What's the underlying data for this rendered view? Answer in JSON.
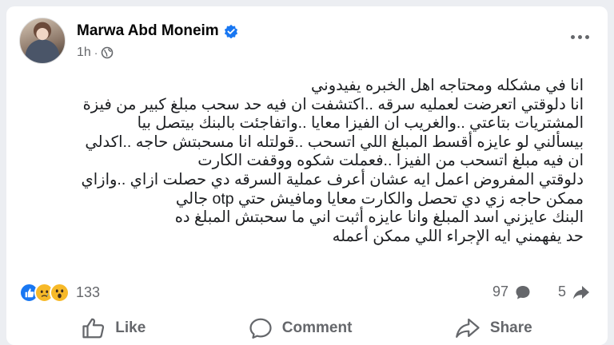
{
  "post": {
    "author": "Marwa Abd Moneim",
    "time": "1h",
    "lines": [
      "انا في مشكله ومحتاجه اهل الخبره يفيدوني",
      "انا دلوقتي اتعرضت لعمليه سرقه ..اكتشفت ان فيه حد سحب مبلغ كبير من فيزة",
      "المشتريات بتاعتي ..والغريب ان الفيزا معايا ..واتفاجئت بالبنك بيتصل بيا",
      "بيسألني لو عايزه أقسط المبلغ اللي اتسحب ..قولتله انا مسحبتش حاجه ..اكدلي",
      "ان فيه مبلغ اتسحب من الفيزا ..فعملت شكوه ووقفت الكارت",
      "دلوقتي المفروض اعمل ايه عشان أعرف عملية السرقه دي حصلت ازاي ..وازاي",
      "ممكن حاجه زي دي تحصل والكارت معايا ومافيش حتي otp جالي",
      "البنك عايزني اسد المبلغ وانا عايزه أثبت اني ما سحبتش المبلغ ده",
      "حد يفهمني ايه الإجراء اللي ممكن أعمله"
    ]
  },
  "stats": {
    "reactions_count": "133",
    "comments_count": "97",
    "shares_count": "5"
  },
  "actions": {
    "like": "Like",
    "comment": "Comment",
    "share": "Share"
  },
  "icons": {
    "verified": "verified-badge-icon",
    "audience": "public-globe-icon",
    "more": "more-options-icon",
    "reactions": [
      "like-reaction-icon",
      "sad-reaction-icon",
      "wow-reaction-icon"
    ],
    "comment_count": "comment-bubble-icon",
    "share_count": "share-arrow-icon"
  },
  "colors": {
    "accent": "#1877f2",
    "muted_text": "#65676b",
    "reaction_yellow": "#f7b928"
  }
}
